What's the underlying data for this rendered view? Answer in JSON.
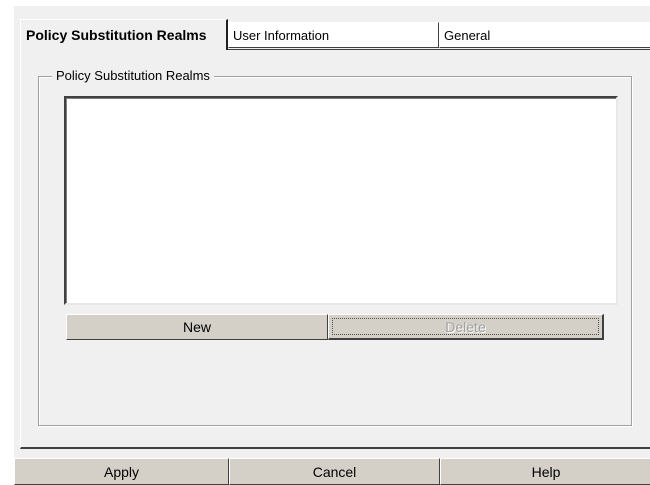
{
  "tabs": [
    {
      "label": "Policy Substitution Realms",
      "active": true
    },
    {
      "label": "User Information",
      "active": false
    },
    {
      "label": "General",
      "active": false
    }
  ],
  "group": {
    "legend": "Policy Substitution Realms",
    "items": []
  },
  "buttons": {
    "new_label": "New",
    "delete_label": "Delete",
    "delete_enabled": false
  },
  "footer": {
    "apply_label": "Apply",
    "cancel_label": "Cancel",
    "help_label": "Help"
  }
}
